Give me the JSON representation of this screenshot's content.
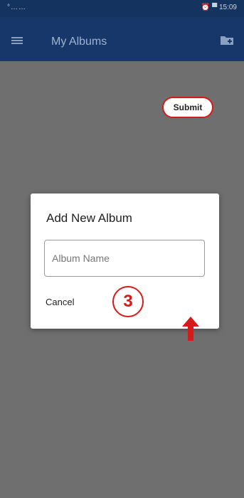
{
  "status_bar": {
    "signal_text": "°……",
    "right_text": "⏰ ▀ 15:09"
  },
  "app_bar": {
    "title": "My Albums",
    "menu_icon": "menu-icon",
    "action_icon": "folder-add-icon"
  },
  "dialog": {
    "title": "Add New Album",
    "album_name_placeholder": "Album Name",
    "cancel_label": "Cancel",
    "submit_label": "Submit"
  },
  "annotation": {
    "step_number": "3",
    "color": "#d61a1a"
  }
}
